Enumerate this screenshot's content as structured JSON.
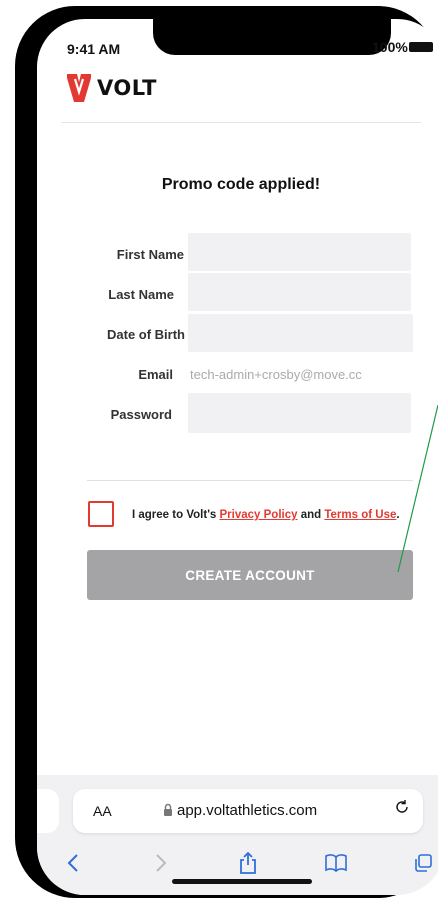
{
  "status_bar": {
    "time": "9:41 AM",
    "battery": "100%"
  },
  "brand": {
    "name": "VOLT",
    "accent": "#e23a32"
  },
  "form": {
    "title": "Promo code applied!",
    "first_name_label": "First Name",
    "last_name_label": "Last Name",
    "dob_label": "Date of Birth",
    "email_label": "Email",
    "email_value": "tech-admin+crosby@move.cc",
    "password_label": "Password",
    "first_name_value": "",
    "last_name_value": "",
    "dob_value": "",
    "password_value": ""
  },
  "consent": {
    "prefix": "I agree to Volt's ",
    "privacy_link": "Privacy Policy",
    "middle": " and ",
    "terms_link": "Terms of Use",
    "suffix": "."
  },
  "create_button": "CREATE ACCOUNT",
  "browser": {
    "text_size_label": "AA",
    "url": "app.voltathletics.com"
  }
}
